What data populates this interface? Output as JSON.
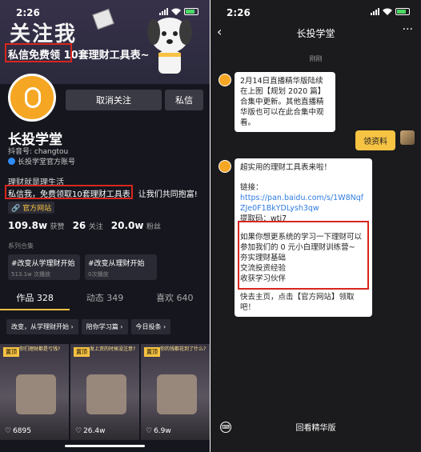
{
  "left": {
    "status": {
      "time": "2:26"
    },
    "banner": {
      "title": "关注我",
      "subtitle": "私信免费领 10套理财工具表~"
    },
    "buttons": {
      "unfollow": "取消关注",
      "message": "私信"
    },
    "profile": {
      "name": "长投学堂",
      "account": "抖音号: changtou",
      "official": "长投学堂官方账号",
      "bio_line1": "理财就是理生活",
      "bio_line2": "私信我，免费领取10套理财工具表，让我们共同抱富!",
      "site": "官方网站"
    },
    "stats": [
      {
        "value": "109.8w",
        "label": "获赞"
      },
      {
        "value": "26",
        "label": "关注"
      },
      {
        "value": "20.0w",
        "label": "粉丝"
      }
    ],
    "recent_label": "系列合集",
    "cards": [
      {
        "title": "#改变从学理财开始",
        "sub": "513.1w 次播放"
      },
      {
        "title": "#改变从理财开始",
        "sub": "0次播放"
      }
    ],
    "tabs": [
      "作品 328",
      "动态 349",
      "喜欢 640"
    ],
    "chips": [
      "改变，从学理财开始 ›",
      "陪你学习篇 ›",
      "今日投条 ›"
    ],
    "videos": [
      {
        "tag": "置顶",
        "caption": "你们理财都是亏钱?",
        "likes": "6895"
      },
      {
        "tag": "置顶",
        "caption": "发上资的时候没注意?",
        "likes": "26.4w"
      },
      {
        "tag": "置顶",
        "caption": "你的钱都花到了什么?",
        "likes": "6.9w"
      }
    ]
  },
  "right": {
    "status": {
      "time": "2:26"
    },
    "title": "长投学堂",
    "timestamp": "刚刚",
    "msg1": "2月14日直播精华版陆续在上图【规划 2020 篇】合集中更新。其他直播精华版也可以在此合集中观看。",
    "reply": "领资料",
    "msg2_intro": "超实用的理财工具表来啦！",
    "msg2_link_label": "链接：",
    "msg2_link": "https://pan.baidu.com/s/1W8NqfZJe0F1BkYDLysh3qw",
    "msg2_code": "提取码：wti7",
    "msg2_promo": "如果你想更系统的学习一下理财可以参加我们的 0 元小白理财训练营~\n夯实理财基础\n交流投资经验\n收获学习伙伴",
    "msg2_outro": "快去主页，点击【官方网站】领取吧！",
    "bottom": "回看精华版"
  },
  "colors": {
    "accent": "#f7c343",
    "highlight": "#d7261e",
    "link": "#2f7ce0"
  }
}
